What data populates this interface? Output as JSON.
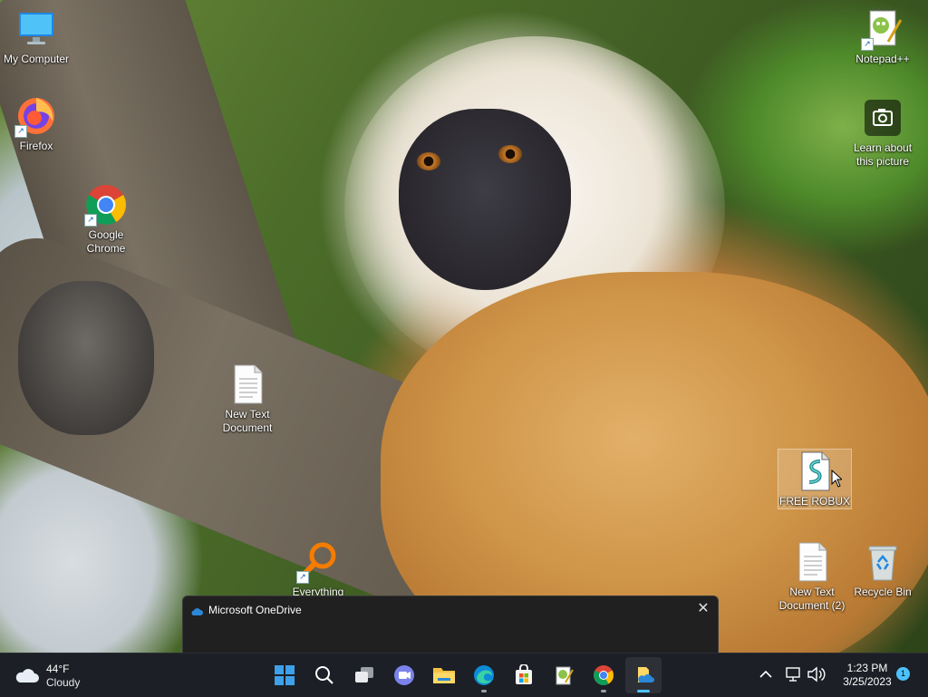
{
  "desktop": {
    "icons": [
      {
        "label": "My Computer"
      },
      {
        "label": "Firefox"
      },
      {
        "label": "Google Chrome"
      },
      {
        "label": "New Text Document"
      },
      {
        "label": "Everything"
      },
      {
        "label": "Notepad++"
      },
      {
        "label": "Learn about this picture"
      },
      {
        "label": "FREE ROBUX"
      },
      {
        "label": "New Text Document (2)"
      },
      {
        "label": "Recycle Bin"
      }
    ]
  },
  "onedrive_flyout": {
    "title": "Microsoft OneDrive",
    "close_symbol": "✕"
  },
  "taskbar": {
    "weather": {
      "temp": "44°F",
      "condition": "Cloudy",
      "icon": "cloud-icon"
    },
    "apps": [
      {
        "name": "start-button",
        "icon": "windows-logo-icon"
      },
      {
        "name": "search-button",
        "icon": "search-icon"
      },
      {
        "name": "task-view-button",
        "icon": "task-view-icon"
      },
      {
        "name": "teams-chat-button",
        "icon": "teams-icon"
      },
      {
        "name": "file-explorer-button",
        "icon": "folder-icon"
      },
      {
        "name": "edge-button",
        "icon": "edge-icon"
      },
      {
        "name": "microsoft-store-button",
        "icon": "store-icon"
      },
      {
        "name": "notepadpp-taskbar-button",
        "icon": "notepadpp-icon"
      },
      {
        "name": "chrome-taskbar-button",
        "icon": "chrome-icon"
      },
      {
        "name": "onedrive-taskbar-button",
        "icon": "onedrive-icon",
        "active": true
      }
    ],
    "tray": {
      "time": "1:23 PM",
      "date": "3/25/2023",
      "notification_count": "1"
    }
  },
  "colors": {
    "taskbar_bg": "#1c1f26",
    "accent": "#4cc2ff",
    "flyout_bg": "#202020"
  }
}
